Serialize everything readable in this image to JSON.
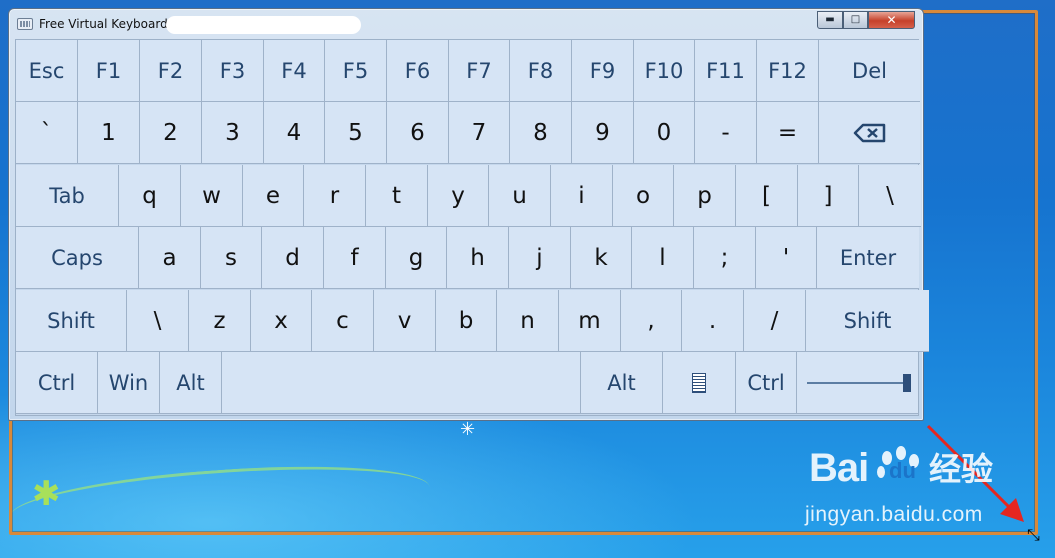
{
  "window": {
    "title": "Free Virtual Keyboard",
    "buttons": {
      "minimize": "▬",
      "maximize": "□",
      "close": "✕"
    }
  },
  "keyboard": {
    "rows": [
      [
        "Esc",
        "F1",
        "F2",
        "F3",
        "F4",
        "F5",
        "F6",
        "F7",
        "F8",
        "F9",
        "F10",
        "F11",
        "F12",
        "Del"
      ],
      [
        "`",
        "1",
        "2",
        "3",
        "4",
        "5",
        "6",
        "7",
        "8",
        "9",
        "0",
        "-",
        "=",
        "backspace"
      ],
      [
        "Tab",
        "q",
        "w",
        "e",
        "r",
        "t",
        "y",
        "u",
        "i",
        "o",
        "p",
        "[",
        "]",
        "\\"
      ],
      [
        "Caps",
        "a",
        "s",
        "d",
        "f",
        "g",
        "h",
        "j",
        "k",
        "l",
        ";",
        "'",
        "Enter"
      ],
      [
        "Shift",
        "\\",
        "z",
        "x",
        "c",
        "v",
        "b",
        "n",
        "m",
        ",",
        ".",
        "/",
        "Shift"
      ],
      [
        "Ctrl",
        "Win",
        "Alt",
        "space",
        "Alt",
        "menu",
        "Ctrl",
        "slider"
      ]
    ]
  },
  "watermark": {
    "logo": "Bai",
    "logo_du": "du",
    "logo_cn": "经验",
    "url": "jingyan.baidu.com"
  },
  "colors": {
    "key_bg": "#d6e4f5",
    "key_border": "#9fb2c9",
    "fn_text": "#25466e",
    "frame_orange": "#d8893a"
  }
}
